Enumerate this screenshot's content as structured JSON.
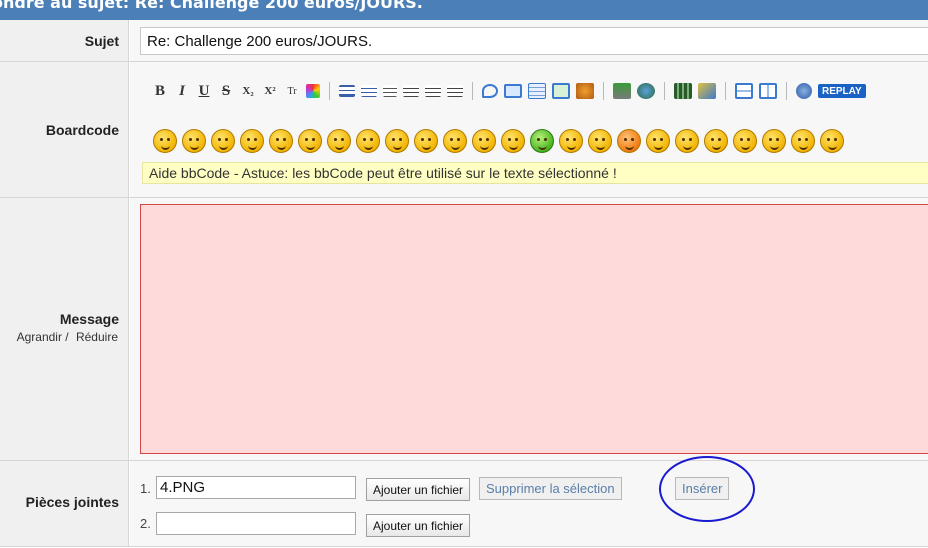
{
  "title": "ondre au sujet: Re: Challenge 200 euros/JOURS.",
  "subject": {
    "label": "Sujet",
    "value": "Re: Challenge 200 euros/JOURS."
  },
  "boardcode": {
    "label": "Boardcode",
    "toolbar": {
      "bold": "B",
      "italic": "I",
      "underline": "U",
      "strike": "S",
      "subscript": "X₂",
      "superscript": "X²",
      "font_size": "Tr",
      "replay": "REPLAY"
    },
    "smiley_count": 24,
    "help_text": "Aide bbCode - Astuce: les bbCode peut être utilisé sur le texte sélectionné !"
  },
  "message": {
    "label": "Message",
    "enlarge": "Agrandir /",
    "reduce": "Réduire",
    "value": ""
  },
  "attachments": {
    "label": "Pièces jointes",
    "rows": [
      {
        "num": "1.",
        "value": "4.PNG",
        "add_label": "Ajouter un fichier"
      },
      {
        "num": "2.",
        "value": "",
        "add_label": "Ajouter un fichier"
      }
    ],
    "remove_label": "Supprimer la sélection",
    "insert_label": "Insérer"
  },
  "colors": {
    "title_bar": "#4a7fb8",
    "message_bg": "#ffdada",
    "help_bg": "#ffffc4",
    "annotation": "#1a1ad0"
  }
}
